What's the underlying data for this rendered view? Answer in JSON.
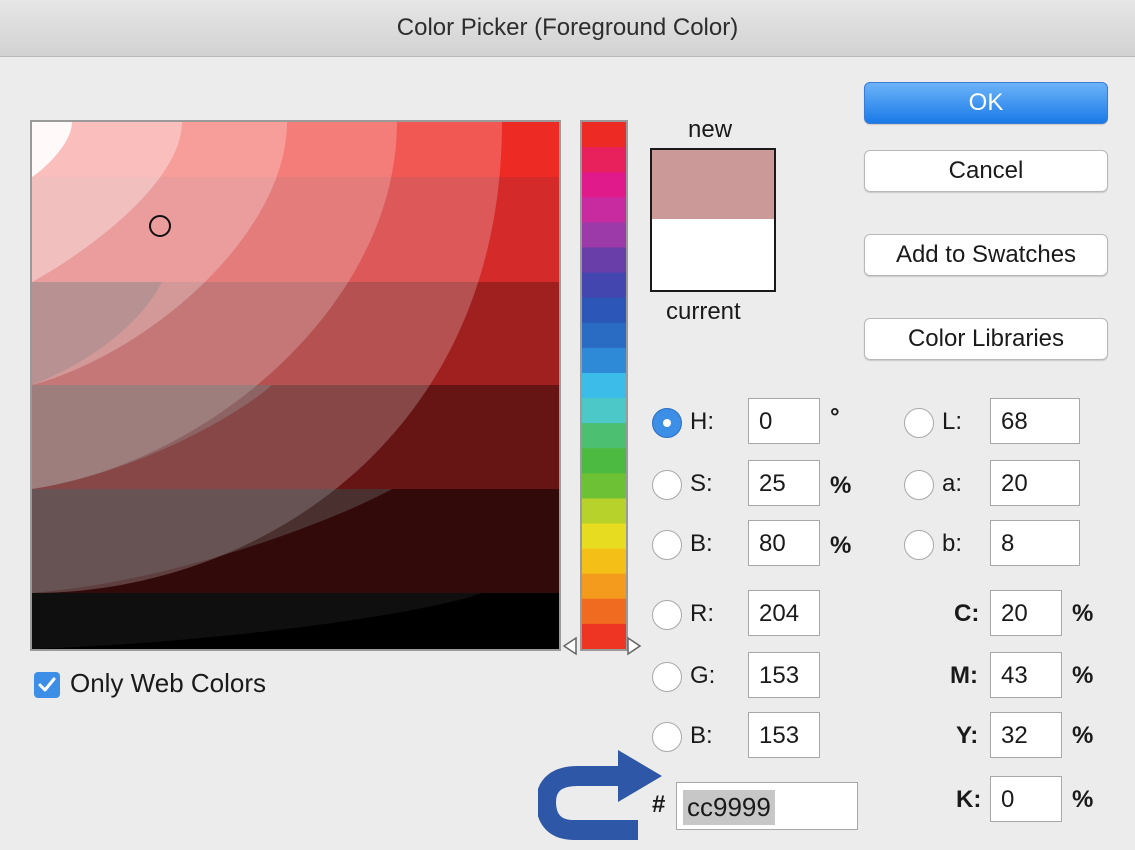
{
  "window": {
    "title": "Color Picker (Foreground Color)"
  },
  "swatch": {
    "new_label": "new",
    "current_label": "current",
    "new_color": "#cc9999",
    "current_color": "#ffffff"
  },
  "buttons": {
    "ok": "OK",
    "cancel": "Cancel",
    "add_to_swatches": "Add to Swatches",
    "color_libraries": "Color Libraries"
  },
  "hsb": [
    {
      "label": "H:",
      "value": "0",
      "unit": "°",
      "selected": true
    },
    {
      "label": "S:",
      "value": "25",
      "unit": "%",
      "selected": false
    },
    {
      "label": "B:",
      "value": "80",
      "unit": "%",
      "selected": false
    }
  ],
  "rgb": [
    {
      "label": "R:",
      "value": "204",
      "selected": false
    },
    {
      "label": "G:",
      "value": "153",
      "selected": false
    },
    {
      "label": "B:",
      "value": "153",
      "selected": false
    }
  ],
  "lab": [
    {
      "label": "L:",
      "value": "68",
      "selected": false
    },
    {
      "label": "a:",
      "value": "20",
      "selected": false
    },
    {
      "label": "b:",
      "value": "8",
      "selected": false
    }
  ],
  "cmyk": [
    {
      "label": "C:",
      "value": "20",
      "unit": "%"
    },
    {
      "label": "M:",
      "value": "43",
      "unit": "%"
    },
    {
      "label": "Y:",
      "value": "32",
      "unit": "%"
    },
    {
      "label": "K:",
      "value": "0",
      "unit": "%"
    }
  ],
  "hex": {
    "prefix": "#",
    "value": "cc9999"
  },
  "web_colors": {
    "label": "Only Web Colors",
    "checked": true
  },
  "hue_colors": [
    "#ee2a24",
    "#e8205c",
    "#e01a8a",
    "#c82aa0",
    "#9b3aa8",
    "#6a3ea8",
    "#4446b0",
    "#2c56b8",
    "#2a6cc4",
    "#2e8ad6",
    "#3cbce8",
    "#4cc8c8",
    "#4cc070",
    "#4cba40",
    "#6cc234",
    "#b8d22c",
    "#e8dc20",
    "#f4c018",
    "#f49a1c",
    "#f06a20",
    "#ee3422"
  ],
  "colors": {
    "accent": "#3c8ee6",
    "arrow": "#2e57a8",
    "selection": "#c7c7c7"
  }
}
